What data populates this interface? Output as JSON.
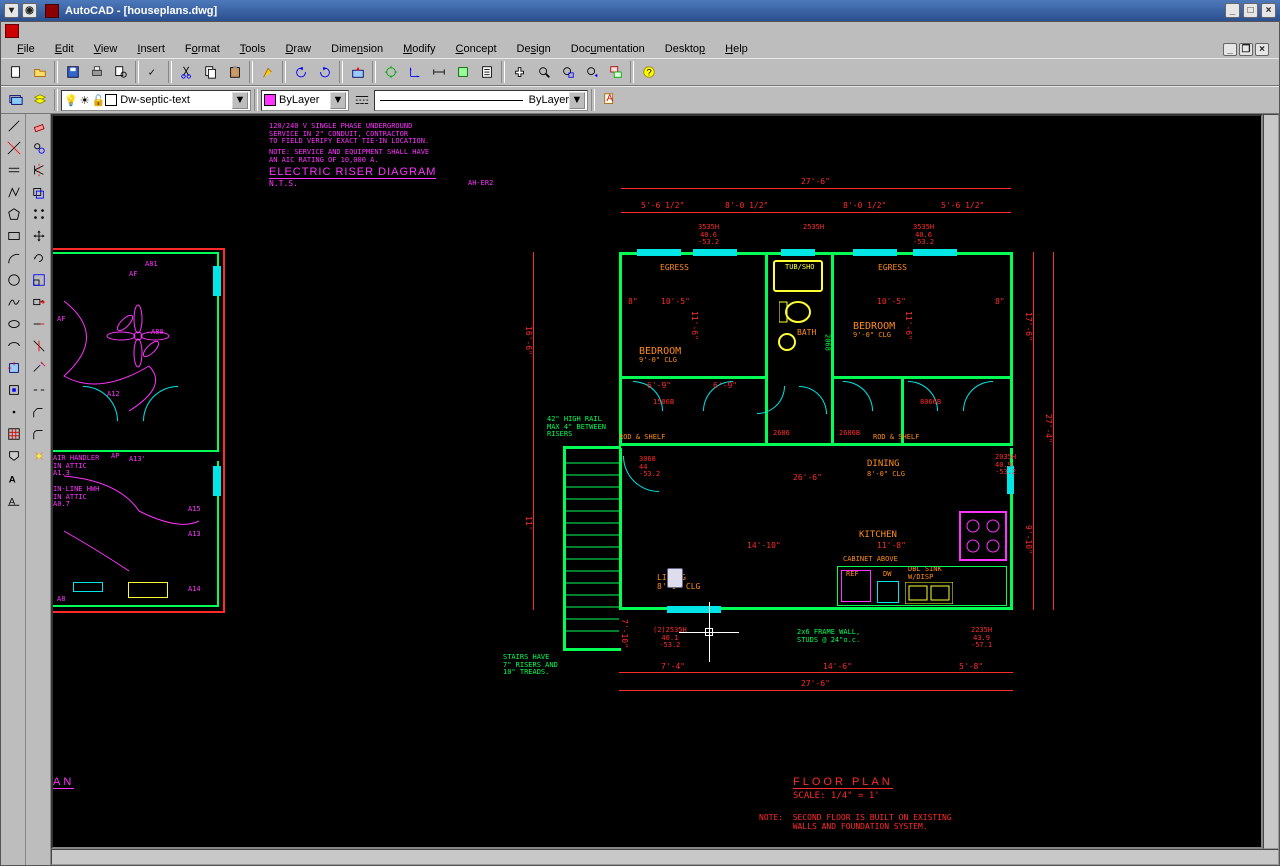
{
  "wm": {
    "title": "AutoCAD - [houseplans.dwg]",
    "btn_menu": "▾",
    "btn_sticky": "◉",
    "btn_min": "_",
    "btn_max": "□",
    "btn_close": "×"
  },
  "menu": [
    {
      "l": "F",
      "t": "ile"
    },
    {
      "l": "E",
      "t": "dit"
    },
    {
      "l": "V",
      "t": "iew"
    },
    {
      "l": "I",
      "t": "nsert"
    },
    {
      "l": "",
      "t": "Format",
      "u": 1
    },
    {
      "l": "T",
      "t": "ools"
    },
    {
      "l": "D",
      "t": "raw"
    },
    {
      "l": "",
      "t": "Dimension",
      "u": 4
    },
    {
      "l": "M",
      "t": "odify"
    },
    {
      "l": "C",
      "t": "oncept"
    },
    {
      "l": "",
      "t": "Design",
      "u": 2
    },
    {
      "l": "",
      "t": "Documentation",
      "u": 3
    },
    {
      "l": "",
      "t": "Desktop",
      "u": 6
    },
    {
      "l": "H",
      "t": "elp"
    }
  ],
  "toolbar1_icons": [
    "new",
    "open",
    "save",
    "print",
    "preview",
    "spell",
    "cut",
    "copy",
    "paste",
    "match",
    "undo",
    "redo",
    "launch",
    "osnap",
    "ucs",
    "dist",
    "area",
    "list",
    "pan",
    "zoomrt",
    "zoomwin",
    "zoomprev",
    "props",
    "help"
  ],
  "layer": {
    "current": "Dw-septic-text",
    "swatch": "#ff33ff",
    "color_label": "ByLayer",
    "color_swatch": "#ff33ff",
    "ltype_label": "ByLayer"
  },
  "left_draw_icons": [
    "line",
    "xline",
    "mline",
    "pline",
    "polygon",
    "rect",
    "arc",
    "circle",
    "spline",
    "ellipse",
    "ellipsearc",
    "insert",
    "block",
    "point",
    "hatch",
    "region",
    "mtext",
    "dtext"
  ],
  "left_mod_icons": [
    "erase",
    "copy",
    "mirror",
    "offset",
    "array",
    "move",
    "rotate",
    "scale",
    "stretch",
    "lengthen",
    "trim",
    "extend",
    "break",
    "chamfer",
    "fillet",
    "explode"
  ],
  "drawing": {
    "elec_note1": "120/240 V SINGLE PHASE UNDERGROUND\nSERVICE IN 2\" CONDUIT, CONTRACTOR\nTO FIELD VERIFY EXACT TIE-IN LOCATION.",
    "elec_note2": "NOTE: SERVICE AND EQUIPMENT SHALL HAVE\nAN AIC RATING OF 10,000 A.",
    "elec_title": "ELECTRIC RISER DIAGRAM",
    "elec_scale": "N.T.S.",
    "elec_ref": "AH-ER2",
    "fp_title": "FLOOR PLAN",
    "fp_scale": "SCALE: 1/4\" = 1'",
    "fp_note": "NOTE:  SECOND FLOOR IS BUILT ON EXISTING\n       WALLS AND FOUNDATION SYSTEM.",
    "overall_w": "27'-6\"",
    "dim_a": "5'-6 1/2\"",
    "dim_b": "8'-0 1/2\"",
    "dim_c": "8'-0 1/2\"",
    "dim_d": "5'-6 1/2\"",
    "win1": "3535H\n40.6\n-53.2",
    "win2": "2535H",
    "win3": "3535H\n40.6\n-53.2",
    "egress": "EGRESS",
    "tubshd": "TUB/SHO",
    "bath": "BATH",
    "bedroom": "BEDROOM",
    "bed_clg": "9'-0\" CLG",
    "int_a": "10'-5\"",
    "int_b": "11'-6\"",
    "int_c": "10'-5\"",
    "int_d": "8\"",
    "int_e": "8\"",
    "d1": "1506B",
    "d2": "2686",
    "d3": "2686B",
    "d4": "8066B",
    "rod": "ROD & SHELF",
    "rail": "42\" HIGH RAIL\nMAX 4\" BETWEEN\nRISERS",
    "d5": "3068\n44\n-53.2",
    "dining": "DINING",
    "dining_clg": "8'-0\" CLG",
    "kitchen": "KITCHEN",
    "dim_e": "26'-6\"",
    "dim_f": "14'-10\"",
    "dim_g": "11'-8\"",
    "cab": "CABINET ABOVE",
    "ref": "REF",
    "dw": "DW",
    "sink": "DBL SINK\nW/DISP",
    "living": "LIVING\n8'-0\" CLG",
    "studs": "2x6 FRAME WALL,\nSTUDS @ 24\"o.c.",
    "stairs": "STAIRS HAVE\n7\" RISERS AND\n10\" TREADS.",
    "dim_h": "7'-4\"",
    "dim_i": "14'-6\"",
    "dim_j": "5'-8\"",
    "dim_k": "27'-6\"",
    "dim_side_a": "17'-6\"",
    "dim_side_b": "9'-10\"",
    "dim_side_c": "27'-4\"",
    "dim_side_d": "7'-10\"",
    "dim_side_e": "16'-6\"",
    "dim_side_f": "11'",
    "dim_bed_a": "6'-9\"",
    "dim_bed_b": "6'-9\"",
    "win4": "(2)2535H\n40.1\n-53.2",
    "win5": "2235H\n43.9\n-57.1",
    "win6": "2035H\n40.9\n-53.2",
    "elec_tag1": "A81",
    "elec_tag2": "A80",
    "elec_af": "AF",
    "elec_a12": "A12",
    "elec_ap": "AP",
    "elec_a13": "A13'",
    "elec_hndl": "AIR HANDLER\nIN ATTIC\nA1.3",
    "elec_hwh": "IN-LINE HWH\nIN ATTIC\nA0.7",
    "elec_a8": "A8",
    "elec_a14": "A14",
    "elec_a15": "A15",
    "elec_a13b": "A13",
    "plan_left": "AN",
    "d_2068": "2068"
  }
}
